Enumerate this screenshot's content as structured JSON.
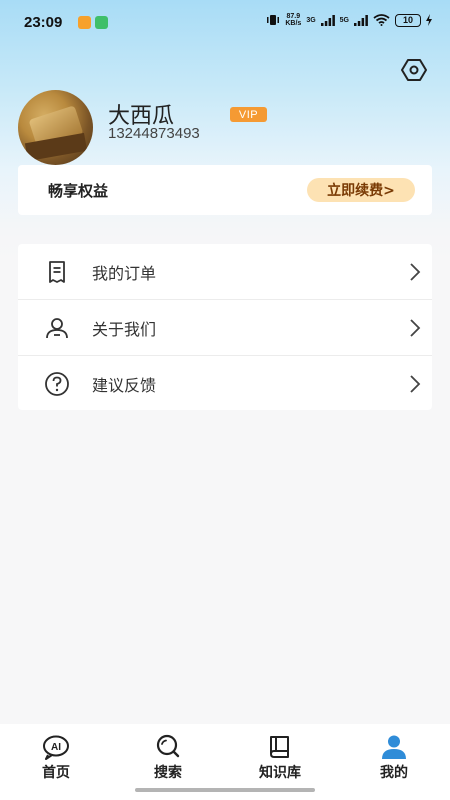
{
  "status_bar": {
    "time": "23:09",
    "net_speed_value": "87.9",
    "net_speed_unit": "KB/s",
    "signal_1": "3G",
    "signal_2": "5G",
    "battery": "10"
  },
  "profile": {
    "username": "大西瓜",
    "vip_label": "VIP",
    "phone": "13244873493"
  },
  "benefits": {
    "label": "畅享权益",
    "renew_label": "立即续费>"
  },
  "menu": {
    "items": [
      {
        "label": "我的订单",
        "icon": "receipt-icon"
      },
      {
        "label": "关于我们",
        "icon": "person-icon"
      },
      {
        "label": "建议反馈",
        "icon": "question-icon"
      }
    ]
  },
  "bottom_nav": {
    "items": [
      {
        "label": "首页",
        "icon": "ai-icon"
      },
      {
        "label": "搜索",
        "icon": "search-icon"
      },
      {
        "label": "知识库",
        "icon": "book-icon"
      },
      {
        "label": "我的",
        "icon": "user-icon"
      }
    ],
    "active_index": 3
  },
  "colors": {
    "accent": "#2f8cd8",
    "vip": "#f59a33",
    "renew_bg": "#fde2b3",
    "renew_text": "#7a3b05"
  }
}
